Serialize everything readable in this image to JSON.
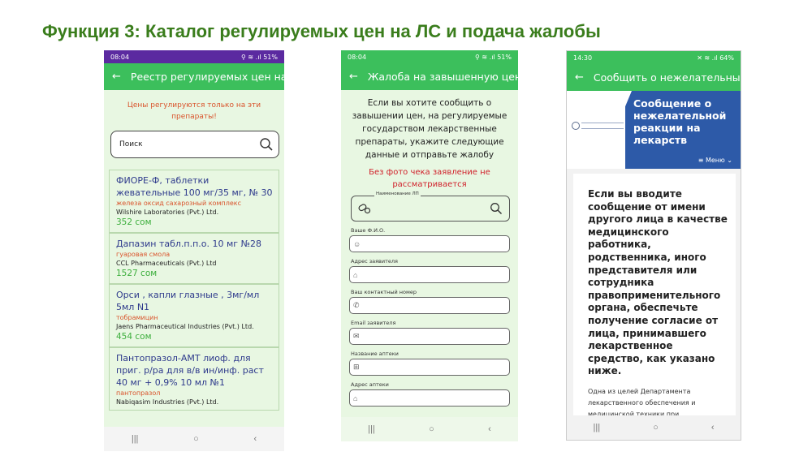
{
  "slide_title": "Функция 3: Каталог регулируемых цен на ЛС и подача жалобы",
  "phone1": {
    "status_time": "08:04",
    "status_right": "51%",
    "appbar_title": "Реестр регулируемых цен на...",
    "notice": "Цены регулируются только на эти препараты!",
    "search_placeholder": "Поиск",
    "drugs": [
      {
        "name": "ФИОРЕ-Ф, таблетки жевательные 100 мг/35 мг, № 30",
        "inn": "железа оксид сахарозный комплекс",
        "maker": "Wilshire Laboratories (Pvt.) Ltd.",
        "price": "352 сом"
      },
      {
        "name": "Дапазин табл.п.п.о. 10 мг №28",
        "inn": "гуаровая смола",
        "maker": "CCL Pharmaceuticals (Pvt.) Ltd",
        "price": "1527 сом"
      },
      {
        "name": "Орси , капли глазные , 3мг/мл 5мл N1",
        "inn": "тобрамицин",
        "maker": "Jaens Pharmaceutical Industries (Pvt.) Ltd.",
        "price": "454 сом"
      },
      {
        "name": "Пантопразол-АМТ лиоф. для приг. р/ра для в/в ин/инф. раст 40 мг + 0,9% 10 мл №1",
        "inn": "пантопразол",
        "maker": "Nabiqasim Industries (Pvt.) Ltd.",
        "price": ""
      }
    ]
  },
  "phone2": {
    "status_time": "08:04",
    "status_right": "51%",
    "appbar_title": "Жалоба на завышенную цену",
    "intro": "Если вы хотите сообщить о завышении цен, на регулируемые государством лекарственные препараты, укажите следующие данные и  отправьте жалобу",
    "warning": "Без фото чека заявление не рассматривается",
    "drug_field_label": "Наименование ЛП",
    "fields": [
      {
        "label": "Ваше Ф.И.О.",
        "icon": "user-icon"
      },
      {
        "label": "Адрес заявителя",
        "icon": "home-icon"
      },
      {
        "label": "Ваш контактный номер",
        "icon": "phone-icon"
      },
      {
        "label": "Email заявителя",
        "icon": "mail-icon"
      },
      {
        "label": "Название аптеки",
        "icon": "pharmacy-icon"
      },
      {
        "label": "Адрес аптеки",
        "icon": "home-icon"
      }
    ]
  },
  "phone3": {
    "status_time": "14:30",
    "status_right": "64%",
    "appbar_title": "Сообщить о нежелательных...",
    "banner_title": "Сообщение о нежелательной реакции на лекарств",
    "menu_label": "Меню",
    "card_title": "Если вы вводите сообщение от имени другого лица в качестве медицинского работника, родственника, иного представителя или сотрудника правоприменительного органа, обеспечьте получение согласие от лица, принимавшего лекарственное средство, как указано ниже.",
    "card_body": "Одна из целей Департамента лекарственного обеспечения и медицинской техники при"
  },
  "nav": {
    "recent": "|||",
    "home": "○",
    "back": "‹"
  },
  "colors": {
    "title_green": "#3a7d1c",
    "app_green": "#3cbf5c",
    "status_purple": "#5b2aa0",
    "banner_blue": "#2d5aa8",
    "price_green": "#3cae3c",
    "inn_orange": "#d9532b",
    "name_blue": "#2e3a8c",
    "warning_red": "#d0202a"
  }
}
